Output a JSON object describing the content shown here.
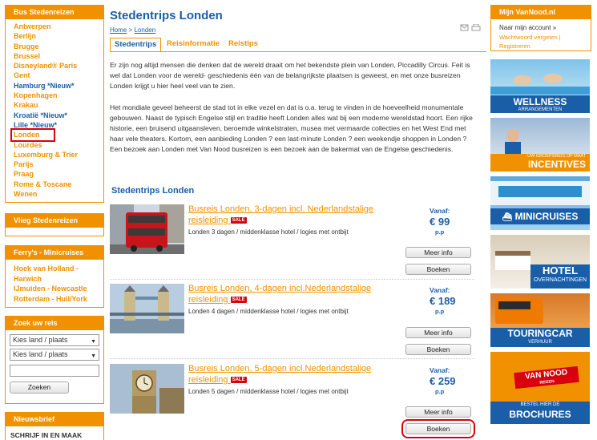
{
  "left": {
    "bus_box": {
      "title": "Bus Stedenreizen",
      "cities": [
        {
          "label": "Antwerpen",
          "color": "orange"
        },
        {
          "label": "Berlijn",
          "color": "orange"
        },
        {
          "label": "Brugge",
          "color": "orange"
        },
        {
          "label": "Brussel",
          "color": "orange"
        },
        {
          "label": "Disneyland® Paris",
          "color": "orange"
        },
        {
          "label": "Gent",
          "color": "orange"
        },
        {
          "label": "Hamburg *Nieuw*",
          "color": "blue"
        },
        {
          "label": "Kopenhagen",
          "color": "orange"
        },
        {
          "label": "Krakau",
          "color": "orange"
        },
        {
          "label": "Kroatië *Nieuw*",
          "color": "blue"
        },
        {
          "label": "Lille *Nieuw*",
          "color": "blue"
        },
        {
          "label": "Londen",
          "color": "orange",
          "selected": true
        },
        {
          "label": "Lourdes",
          "color": "orange"
        },
        {
          "label": "Luxemburg & Trier",
          "color": "orange"
        },
        {
          "label": "Parijs",
          "color": "orange"
        },
        {
          "label": "Praag",
          "color": "orange"
        },
        {
          "label": "Rome & Toscane",
          "color": "orange"
        },
        {
          "label": "Wenen",
          "color": "orange"
        }
      ]
    },
    "vlieg_box": {
      "title": "Vlieg Stedenreizen"
    },
    "ferry_box": {
      "title": "Ferry's - Minicruises",
      "items": [
        "Hoek van Holland - Harwich",
        "IJmuiden - Newcastle",
        "Rotterdam - Hull/York"
      ]
    },
    "search_box": {
      "title": "Zoek uw reis",
      "select1": "Kies land / plaats",
      "select2": "Kies land / plaats",
      "button": "Zoeken"
    },
    "news_box": {
      "title": "Nieuwsbrief",
      "text": "SCHRIJF IN EN MAAK KANS:"
    }
  },
  "main": {
    "title": "Stedentrips Londen",
    "breadcrumb": {
      "home": "Home",
      "sep": " > ",
      "current": "Londen"
    },
    "tabs": [
      "Stedentrips",
      "Reisinformatie",
      "Reistips"
    ],
    "para1": "Er zijn nog altijd mensen die denken dat de wereld draait om het bekendste plein van Londen, Piccadilly Circus. Feit is wel dat Londen voor de wereld- geschiedenis één van de belangrijkste plaatsen is geweest, en met onze busreizen Londen krijgt u hier heel veel van te zien.",
    "para2": "Het mondiale geveel beheerst de stad tot in elke vezel en dat is o.a. terug te vinden in de hoeveelheid monumentale gebouwen. Naast de typisch Engelse stijl en traditie heeft Londen alles wat bij een moderne wereldstad hoort. Een rijke historie, een bruisend uitgaansleven, beroemde winkelstraten, musea met vermaarde collecties en het West End met haar vele theaters. Kortom, een aanbieding Londen ? een last-minute Londen ? een weekendje shoppen in Londen ? Een bezoek aan Londen met Van Nood busreizen is een bezoek aan de bakermat van de Engelse geschiedenis.",
    "trips_heading": "Stedentrips Londen",
    "trips": [
      {
        "title": "Busreis Londen, 3-dagen incl. Nederlandstalige reisleiding",
        "sale": "SALE",
        "desc": "Londen 3 dagen / middenklasse hotel / logies met ontbijt",
        "vanaf": "Vanaf:",
        "price": "€ 99",
        "pp": "p.p",
        "info_btn": "Meer info",
        "book_btn": "Boeken",
        "image": "red-double-decker-bus"
      },
      {
        "title": "Busreis Londen, 4-dagen incl.Nederlandstalige reisleiding",
        "sale": "SALE",
        "desc": "Londen 4 dagen / middenklasse hotel / logies met ontbijt",
        "vanaf": "Vanaf:",
        "price": "€ 189",
        "pp": "p.p",
        "info_btn": "Meer info",
        "book_btn": "Boeken",
        "image": "tower-bridge"
      },
      {
        "title": "Busreis Londen, 5-dagen incl.Nederlandstalige reisleiding",
        "sale": "SALE",
        "desc": "Londen 5 dagen / middenklasse hotel / logies met ontbijt",
        "vanaf": "Vanaf:",
        "price": "€ 259",
        "pp": "p.p",
        "info_btn": "Meer info",
        "book_btn": "Boeken",
        "image": "big-ben"
      }
    ]
  },
  "right": {
    "account_box": {
      "title": "Mijn VanNood.nl",
      "label": "Naar mijn account »",
      "forgot": "Wachtwoord vergeten",
      "sep": " | ",
      "register": "Registreren"
    },
    "banners": [
      {
        "title": "WELLNESS",
        "sub": "ARRANGEMENTEN"
      },
      {
        "title": "INCENTIVES",
        "sub": "UW GROEPSREIS OP MAAT"
      },
      {
        "title": "MINICRUISES",
        "sub": ""
      },
      {
        "title": "HOTEL",
        "sub": "OVERNACHTINGEN"
      },
      {
        "title": "TOURINGCAR",
        "sub": "VERHUUR"
      },
      {
        "title": "BROCHURES",
        "sub": "BESTEL HIER DE",
        "logo": "VAN NOOD",
        "logo_sub": "REIZEN"
      }
    ]
  },
  "colors": {
    "orange": "#f29100",
    "blue": "#1a5ea8",
    "red": "#d9000d"
  }
}
